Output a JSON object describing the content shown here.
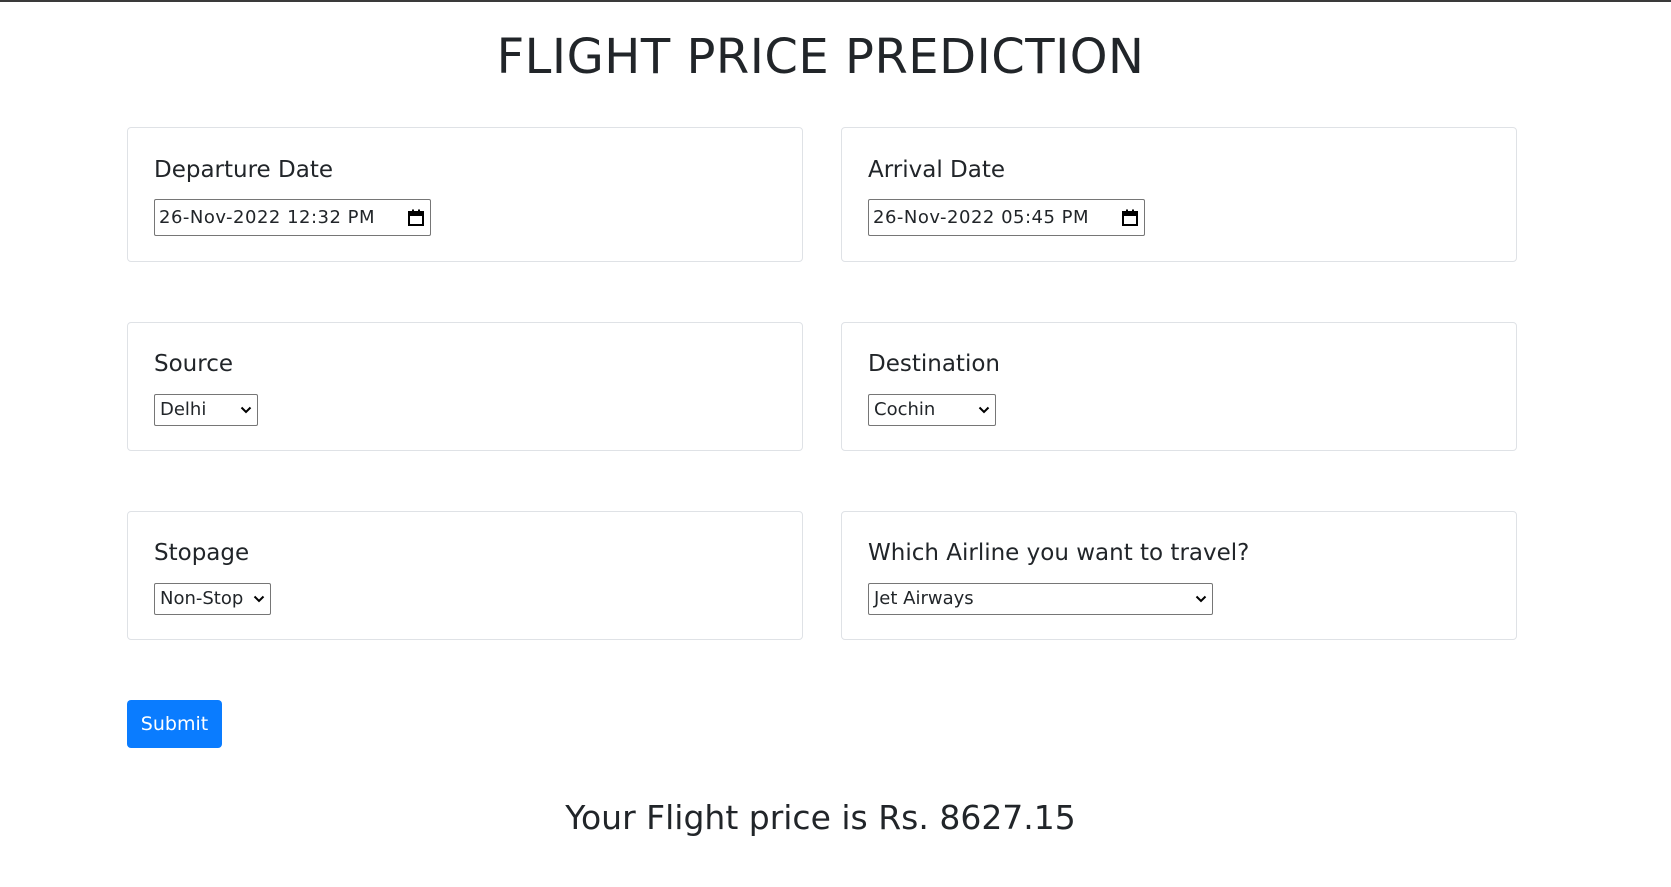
{
  "title": "FLIGHT PRICE PREDICTION",
  "fields": {
    "departure": {
      "label": "Departure Date",
      "value": "26-Nov-2022  12:32  PM"
    },
    "arrival": {
      "label": "Arrival Date",
      "value": "26-Nov-2022  05:45  PM"
    },
    "source": {
      "label": "Source",
      "value": "Delhi"
    },
    "destination": {
      "label": "Destination",
      "value": "Cochin"
    },
    "stopage": {
      "label": "Stopage",
      "value": "Non-Stop"
    },
    "airline": {
      "label": "Which Airline you want to travel?",
      "value": "Jet Airways"
    }
  },
  "submit_label": "Submit",
  "result_text": "Your Flight price is Rs. 8627.15",
  "colors": {
    "accent": "#0a7cff",
    "text": "#212529",
    "card_border": "#dfe2e6"
  },
  "icons": {
    "date_picker": "calendar-icon",
    "dropdown": "chevron-down-icon"
  }
}
